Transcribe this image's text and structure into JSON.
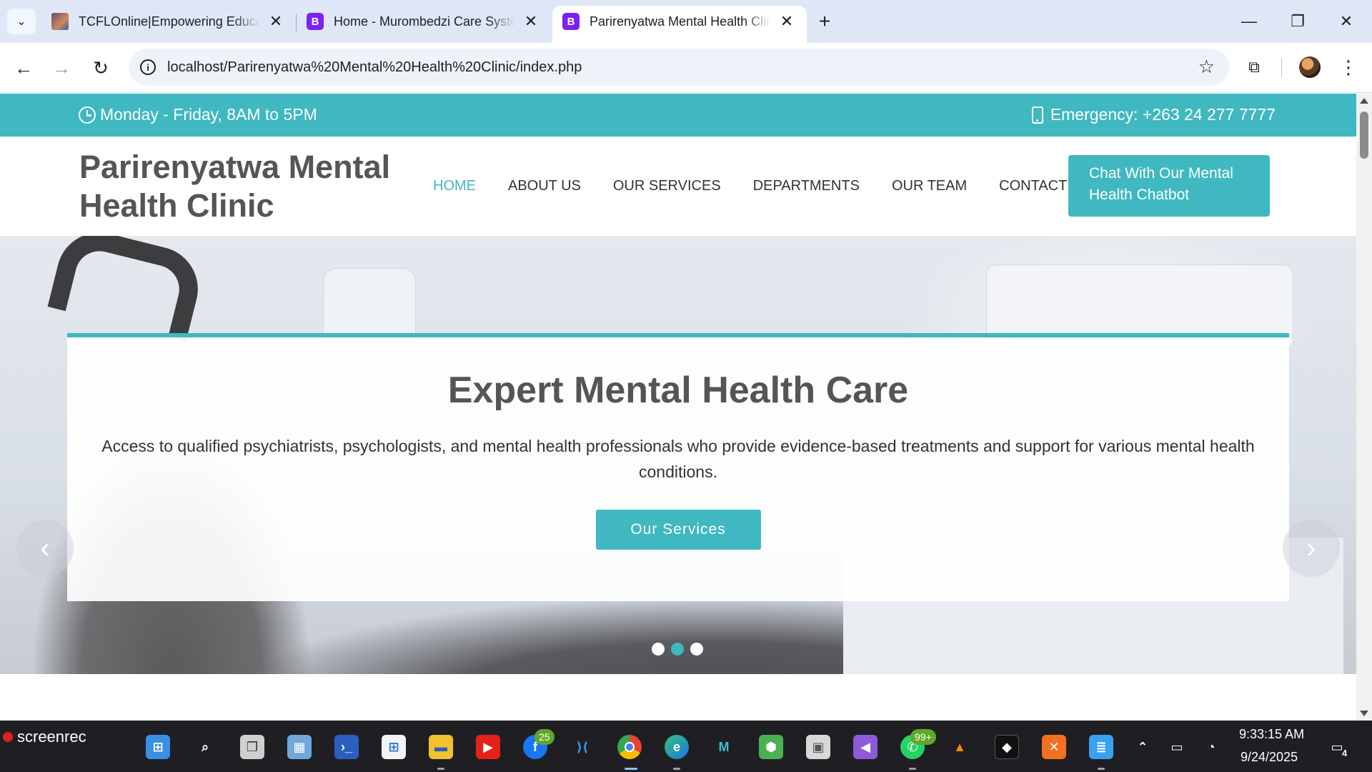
{
  "browser": {
    "tabs": [
      {
        "title": "TCFLOnline|Empowering Educators",
        "favicon": "tcfl-favicon"
      },
      {
        "title": "Home - Murombedzi Care System",
        "favicon": "bootstrap-favicon"
      },
      {
        "title": "Parirenyatwa Mental Health Clinic",
        "favicon": "bootstrap-favicon"
      }
    ],
    "url": "localhost/Parirenyatwa%20Mental%20Health%20Clinic/index.php"
  },
  "topbar": {
    "hours": "Monday - Friday, 8AM to 5PM",
    "emergency": "Emergency: +263 24 277 7777"
  },
  "header": {
    "brand_line1": "Parirenyatwa Mental",
    "brand_line2": "Health Clinic",
    "nav": [
      "HOME",
      "ABOUT US",
      "OUR SERVICES",
      "DEPARTMENTS",
      "OUR TEAM",
      "CONTACT"
    ],
    "chat_line1": "Chat With Our Mental",
    "chat_line2": "Health Chatbot"
  },
  "hero": {
    "title": "Expert Mental Health Care",
    "description": "Access to qualified psychiatrists, psychologists, and mental health professionals who provide evidence-based treatments and support for various mental health conditions.",
    "button": "Our Services",
    "slide_count": 3,
    "active_slide": 2
  },
  "taskbar": {
    "screenrec": "screenrec",
    "badge_facebook": "25",
    "badge_whatsapp": "99+",
    "time": "9:33:15 AM",
    "date": "9/24/2025",
    "notifications": "4"
  },
  "colors": {
    "accent": "#3fb8c1",
    "brand_text": "#555555",
    "tab_strip": "#dfe7f7",
    "taskbar": "#1f1f23"
  }
}
